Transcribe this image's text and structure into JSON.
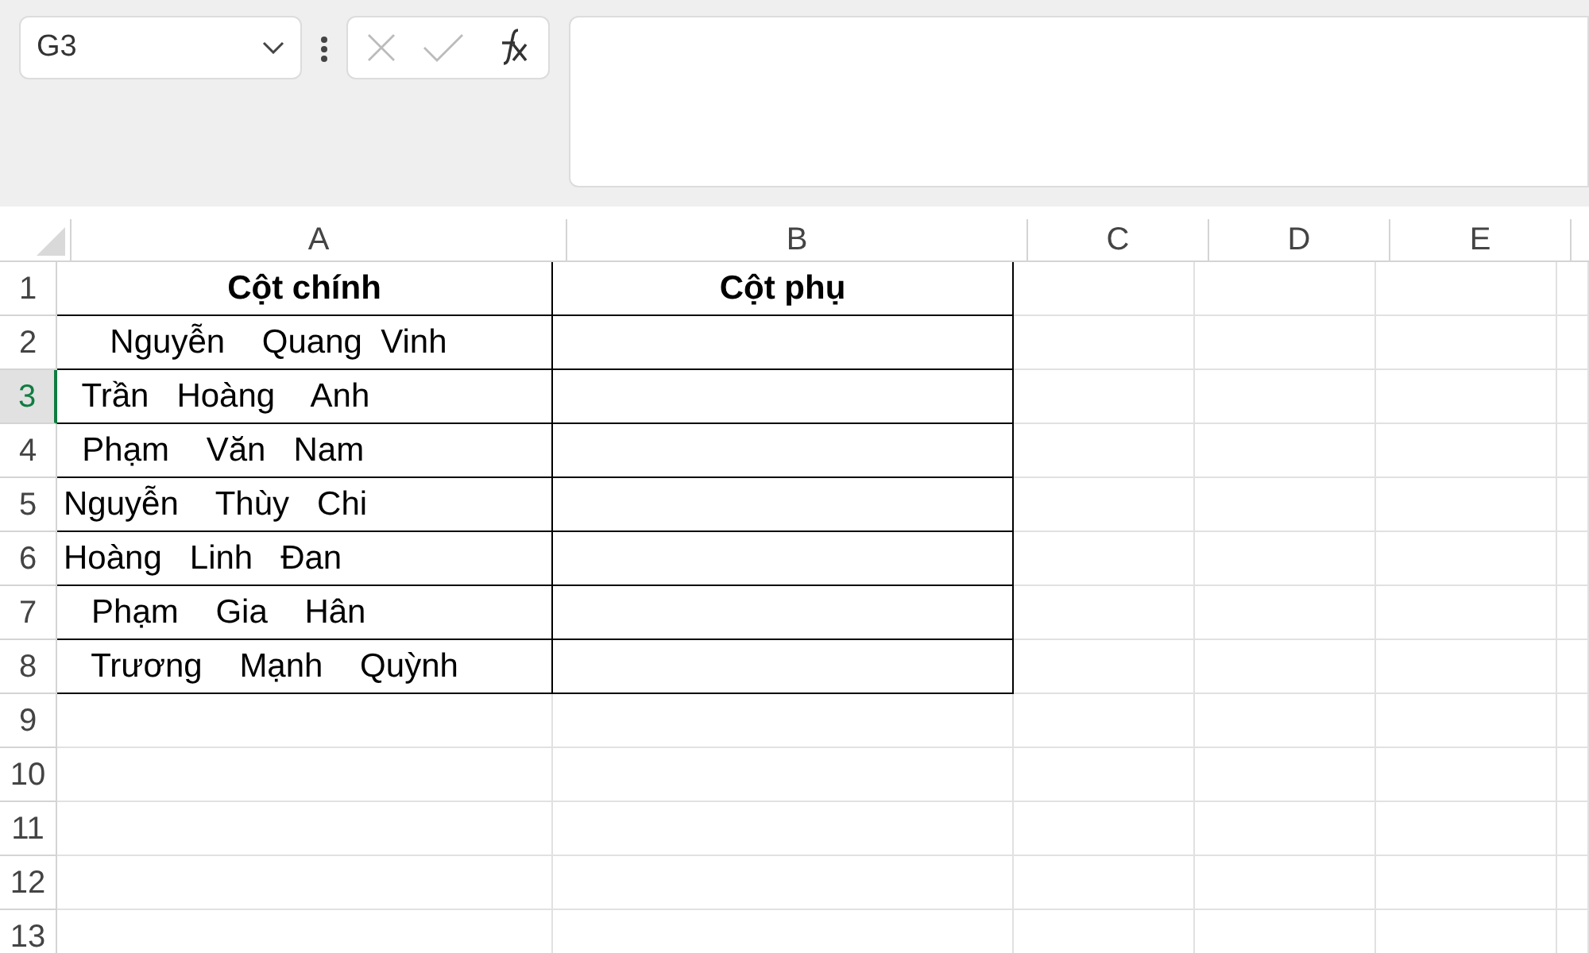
{
  "name_box": {
    "value": "G3"
  },
  "formula_bar": {
    "cancel_disabled": true,
    "enter_disabled": true
  },
  "columns": [
    {
      "label": "A",
      "selected": false
    },
    {
      "label": "B",
      "selected": false
    },
    {
      "label": "C",
      "selected": false
    },
    {
      "label": "D",
      "selected": false
    },
    {
      "label": "E",
      "selected": false
    }
  ],
  "rows": [
    {
      "label": "1",
      "selected": false,
      "kind": "header",
      "cells": [
        "Cột chính",
        "Cột phụ"
      ]
    },
    {
      "label": "2",
      "selected": false,
      "kind": "data",
      "cells": [
        "     Nguyễn    Quang  Vinh"
      ]
    },
    {
      "label": "3",
      "selected": true,
      "kind": "data",
      "cells": [
        "  Trần   Hoàng    Anh"
      ]
    },
    {
      "label": "4",
      "selected": false,
      "kind": "data",
      "cells": [
        "  Phạm    Văn   Nam"
      ]
    },
    {
      "label": "5",
      "selected": false,
      "kind": "data",
      "cells": [
        "Nguyễn    Thùy   Chi"
      ]
    },
    {
      "label": "6",
      "selected": false,
      "kind": "data",
      "cells": [
        "Hoàng   Linh   Đan"
      ]
    },
    {
      "label": "7",
      "selected": false,
      "kind": "data",
      "cells": [
        "   Phạm    Gia    Hân"
      ]
    },
    {
      "label": "8",
      "selected": false,
      "kind": "data",
      "cells": [
        "   Trương    Mạnh    Quỳnh"
      ]
    },
    {
      "label": "9",
      "selected": false,
      "kind": "empty",
      "cells": []
    },
    {
      "label": "10",
      "selected": false,
      "kind": "empty",
      "cells": []
    },
    {
      "label": "11",
      "selected": false,
      "kind": "empty",
      "cells": []
    },
    {
      "label": "12",
      "selected": false,
      "kind": "empty",
      "cells": []
    },
    {
      "label": "13",
      "selected": false,
      "kind": "empty",
      "cells": []
    }
  ]
}
